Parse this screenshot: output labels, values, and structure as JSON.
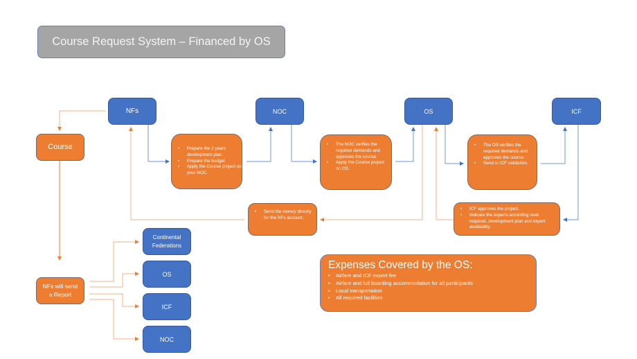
{
  "title": "Course Request System – Financed by OS",
  "colors": {
    "blue": "#4472c4",
    "orange": "#ed7d31",
    "gray": "#a5a5a5",
    "blue_line": "#4472c4",
    "orange_line": "#f4b183"
  },
  "top_row": {
    "nfs": "NFs",
    "noc": "NOC",
    "os": "OS",
    "icf": "ICF"
  },
  "course": "Course",
  "steps": {
    "nf_prepare": [
      "Prepare the 2 years development plan.",
      "Prepare the budget",
      "Apply the Course project on your NOC."
    ],
    "noc_verify": [
      "The NOC verifies the required demands and approves the course.",
      "Apply the Course project on OS."
    ],
    "os_verify": [
      "The OS verifies the required demands and approves the course.",
      "Send to ICF validation."
    ],
    "send_money": [
      "Send the money directly for the NFs account."
    ],
    "icf_approve": [
      "ICF approves the project.",
      "Indicate the experts according level required, development plan and expert availability."
    ]
  },
  "report": {
    "source": "NFs will send a Report",
    "targets": [
      "Continental Federations",
      "OS",
      "ICF",
      "NOC"
    ]
  },
  "expenses": {
    "heading": "Expenses Covered by the OS:",
    "items": [
      "Airfare and ICF expert fee",
      "Airfare and full boarding accommodation for all participants",
      "Local transportation",
      "All required facilities"
    ]
  }
}
